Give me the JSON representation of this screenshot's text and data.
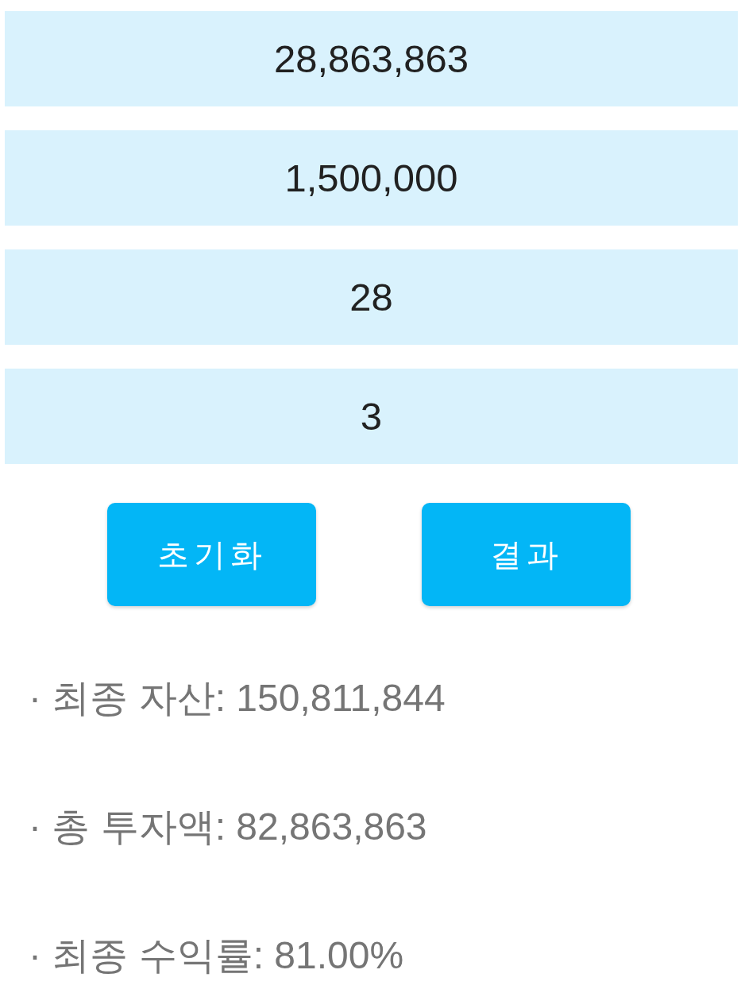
{
  "fields": [
    {
      "value": "28,863,863"
    },
    {
      "value": "1,500,000"
    },
    {
      "value": "28"
    },
    {
      "value": "3"
    }
  ],
  "buttons": [
    {
      "label": "초기화"
    },
    {
      "label": "결과"
    }
  ],
  "results": [
    {
      "text": "· 최종 자산: 150,811,844"
    },
    {
      "text": "· 총 투자액: 82,863,863"
    },
    {
      "text": "· 최종 수익률: 81.00%"
    }
  ]
}
